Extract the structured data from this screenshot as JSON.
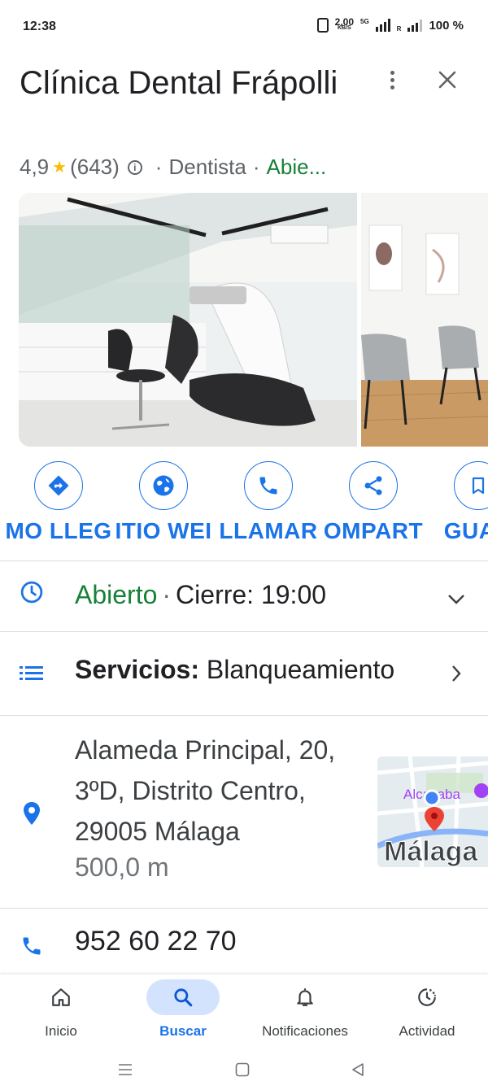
{
  "status_bar": {
    "time": "12:38",
    "net_speed": "2,00",
    "net_unit": "KB/S",
    "net_type": "5G",
    "roaming": "R",
    "battery": "100 %"
  },
  "place": {
    "title": "Clínica Dental Frápolli",
    "rating": "4,9",
    "reviews": "(643)",
    "category": "Dentista",
    "status_short": "Abie..."
  },
  "actions": [
    {
      "label": "MO LLEG",
      "icon": "directions-icon"
    },
    {
      "label": "ITIO WEI",
      "icon": "globe-icon"
    },
    {
      "label": "LLAMAR",
      "icon": "phone-icon"
    },
    {
      "label": "OMPART",
      "icon": "share-icon"
    },
    {
      "label": "GUAR",
      "icon": "bookmark-icon"
    }
  ],
  "hours": {
    "status": "Abierto",
    "separator": "·",
    "closing": "Cierre: 19:00"
  },
  "services": {
    "label": "Servicios:",
    "value": "Blanqueamiento"
  },
  "address": {
    "line1": "Alameda Principal, 20,",
    "line2": "3ºD, Distrito Centro,",
    "line3": "29005 Málaga",
    "distance": "500,0 m",
    "map_label_poi": "Alcazaba",
    "map_label_city": "Málaga"
  },
  "phone": "952 60 22 70",
  "bottom_nav": [
    {
      "label": "Inicio",
      "icon": "home-icon"
    },
    {
      "label": "Buscar",
      "icon": "search-icon"
    },
    {
      "label": "Notificaciones",
      "icon": "bell-icon"
    },
    {
      "label": "Actividad",
      "icon": "activity-icon"
    }
  ],
  "colors": {
    "accent": "#1a73e8",
    "open_green": "#188038",
    "star": "#fbbc04"
  }
}
